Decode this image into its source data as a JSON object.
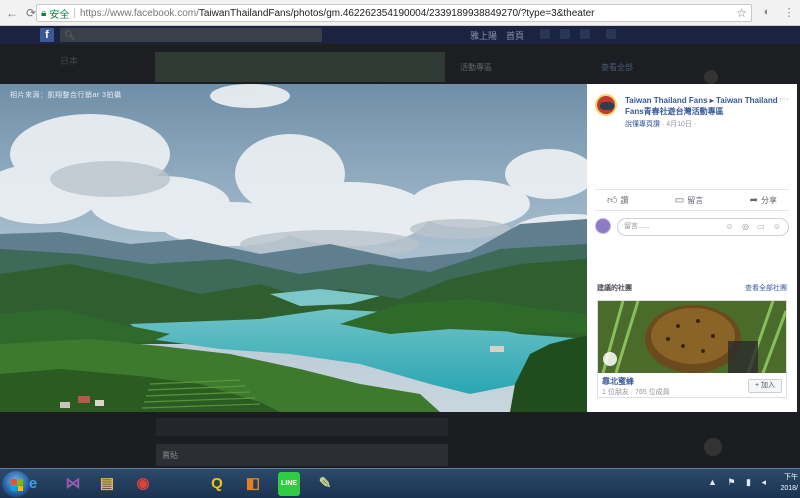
{
  "browser": {
    "secure_label": "安全",
    "separator": "|",
    "url_prefix": "https://www.facebook.com/",
    "url_path": "TaiwanThailandFans/photos/gm.462262354190004/2339189938849270/?type=3&theater",
    "icons": [
      "back-arrow-icon",
      "reload-icon",
      "lock-icon",
      "star-icon",
      "extension-icon",
      "menu-icon"
    ]
  },
  "facebook_header": {
    "logo": "f",
    "user_label": "雅上陽",
    "home_label": "首頁"
  },
  "background_page": {
    "left_text": "日本",
    "right_header": "活動專區",
    "right_link": "查看全部"
  },
  "photo": {
    "credit": "相片來源：凱翔整合行銷ar 3拍攝"
  },
  "post": {
    "title": "Taiwan Thailand Fans ▸ Taiwan Thailand Fans青春社遊台灣活動專區",
    "sub_author": "說懂專頁讚",
    "date": "· 4月10日 ·",
    "more": "⋯"
  },
  "actions": {
    "like": "讚",
    "comment": "留言",
    "share": "分享"
  },
  "comment_input": {
    "placeholder": "留言......",
    "icons": "☺ ◎ ▭ ☺"
  },
  "suggested": {
    "heading": "建議的社團",
    "see_all": "查看全部社團",
    "group": {
      "name": "靠北蜜蜂",
      "stats": "1 位朋友 · 765 位成員",
      "join_label": "+ 加入"
    }
  },
  "lower_page": {
    "label": "賣貼"
  },
  "taskbar": {
    "clock_time": "下午",
    "clock_date": "2018/",
    "apps": [
      {
        "name": "ie-icon",
        "glyph": "e",
        "color": "#3ea0e8"
      },
      {
        "name": "visual-studio-icon",
        "glyph": "⋈",
        "color": "#9b59b6"
      },
      {
        "name": "file-explorer-icon",
        "glyph": "▤",
        "color": "#e5b84a"
      },
      {
        "name": "chrome-icon",
        "glyph": "◉",
        "color": "#db4437"
      },
      {
        "name": "keyboard-icon",
        "glyph": "Q",
        "color": "#f1c40f"
      },
      {
        "name": "outlook-icon",
        "glyph": "◧",
        "color": "#e67e22"
      },
      {
        "name": "line-icon",
        "glyph": "LINE",
        "color": "#2ecc40"
      },
      {
        "name": "notepad-icon",
        "glyph": "✎",
        "color": "#c8d38c"
      }
    ]
  }
}
